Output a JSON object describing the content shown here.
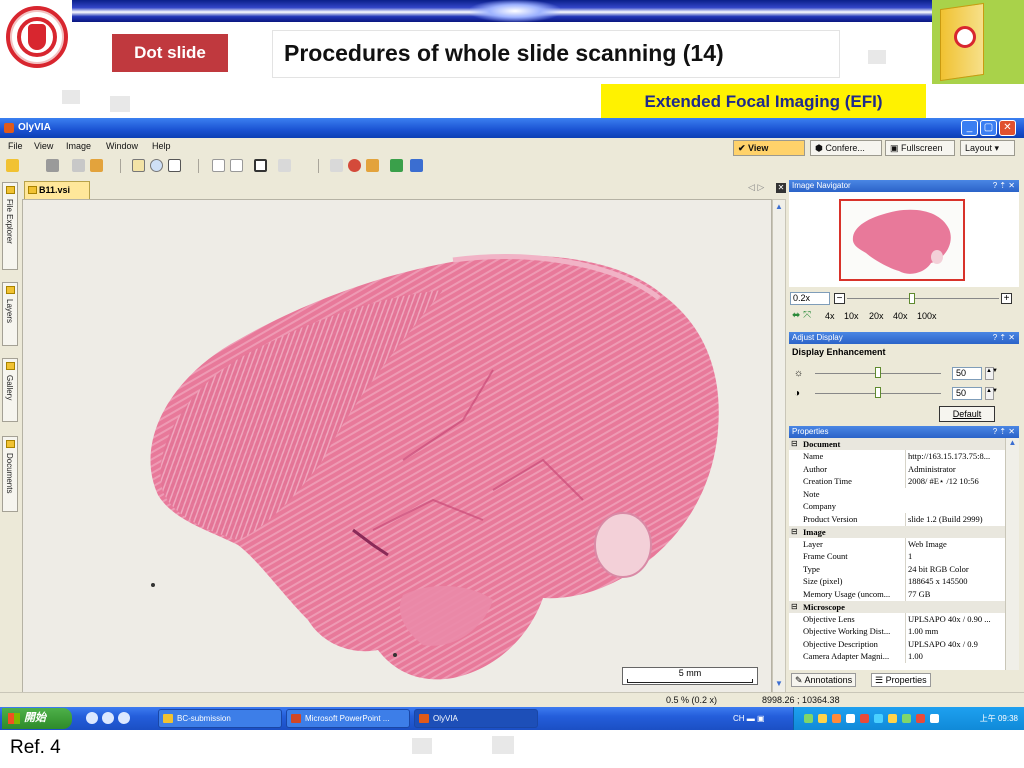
{
  "slide": {
    "label": "Dot slide",
    "title": "Procedures of whole slide scanning (14)",
    "subtitle": "Extended Focal Imaging (EFI)",
    "reference": "Ref. 4"
  },
  "app": {
    "title": "OlyVIA",
    "menu": [
      "File",
      "View",
      "Image",
      "Window",
      "Help"
    ],
    "view_buttons": [
      "View",
      "Confere...",
      "Fullscreen",
      "Layout"
    ],
    "left_tabs": [
      "File Explorer",
      "Layers",
      "Gallery",
      "Documents"
    ],
    "document_tab": "B11.vsi"
  },
  "viewer": {
    "scale_bar": "5 mm",
    "zoom_readout": "0.5 % (0.2 x)",
    "coordinates": "8998.26  ; 10364.38"
  },
  "navigator": {
    "title": "Image Navigator",
    "zoom_value": "0.2x",
    "zoom_levels": [
      "4x",
      "10x",
      "20x",
      "40x",
      "100x"
    ]
  },
  "adjust": {
    "title": "Adjust Display",
    "section": "Display Enhancement",
    "brightness": "50",
    "contrast": "50",
    "default_label": "Default"
  },
  "properties": {
    "title": "Properties",
    "groups": [
      {
        "name": "Document",
        "rows": [
          {
            "k": "Name",
            "v": "http://163.15.173.75:8..."
          },
          {
            "k": "Author",
            "v": "Administrator"
          },
          {
            "k": "Creation Time",
            "v": "2008/  #E⋆ /12 10:56"
          },
          {
            "k": "Note",
            "v": ""
          },
          {
            "k": "Company",
            "v": ""
          },
          {
            "k": "Product Version",
            "v": "slide 1.2 (Build 2999)"
          }
        ]
      },
      {
        "name": "Image",
        "rows": [
          {
            "k": "Layer",
            "v": "Web Image"
          },
          {
            "k": "Frame Count",
            "v": "1"
          },
          {
            "k": "Type",
            "v": "24 bit RGB Color"
          },
          {
            "k": "Size (pixel)",
            "v": "188645 x 145500"
          },
          {
            "k": "Memory Usage (uncom...",
            "v": "77 GB"
          }
        ]
      },
      {
        "name": "Microscope",
        "rows": [
          {
            "k": "Objective Lens",
            "v": "UPLSAPO 40x / 0.90 ..."
          },
          {
            "k": "Objective Working Dist...",
            "v": "1.00 mm"
          },
          {
            "k": "Objective Description",
            "v": "UPLSAPO 40x / 0.9"
          },
          {
            "k": "Camera Adapter Magni...",
            "v": "1.00"
          }
        ]
      }
    ],
    "tabs": [
      "Annotations",
      "Properties"
    ]
  },
  "taskbar": {
    "start": "開始",
    "tasks": [
      "BC-submission",
      "Microsoft PowerPoint ...",
      "OlyVIA"
    ],
    "lang": "CH",
    "clock": "上午 09:38"
  },
  "colors": {
    "tissue": "#e8799a",
    "tissue_dark": "#c94a78",
    "titlebar": "#1a52d2",
    "accent_red": "#c0393e",
    "highlight_yellow": "#fff200"
  }
}
